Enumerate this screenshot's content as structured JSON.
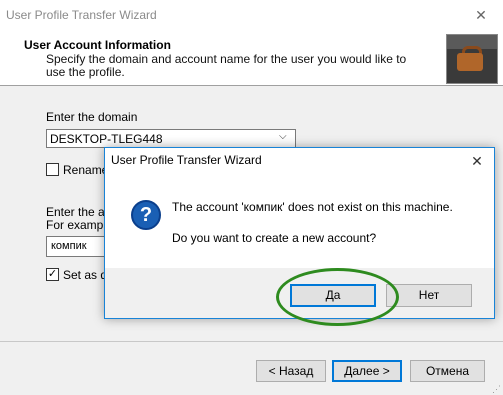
{
  "wizard": {
    "title": "User Profile Transfer Wizard",
    "close_glyph": "✕",
    "header": {
      "title": "User Account  Information",
      "description": "Specify the domain and account name for the user you would like to use the profile."
    },
    "domain_label": "Enter the domain",
    "domain_value": "DESKTOP-TLEG448",
    "rename_label": "Rename",
    "account_label": "Enter the ac",
    "example_label": "For exampl",
    "account_value": "компик",
    "set_default_label": "Set as de",
    "set_default_checked": true,
    "buttons": {
      "back": "< Назад",
      "next": "Далее >",
      "cancel": "Отмена"
    }
  },
  "dialog": {
    "title": "User Profile Transfer Wizard",
    "close_glyph": "✕",
    "icon": "question-icon",
    "icon_glyph": "?",
    "message_line1": "The account 'компик' does not exist on this machine.",
    "message_line2": "Do you want to create a new account?",
    "buttons": {
      "yes": "Да",
      "no": "Нет"
    }
  },
  "colors": {
    "accent": "#0078d7",
    "highlight": "#2e8b1f",
    "icon_blue": "#1a5fb4"
  }
}
